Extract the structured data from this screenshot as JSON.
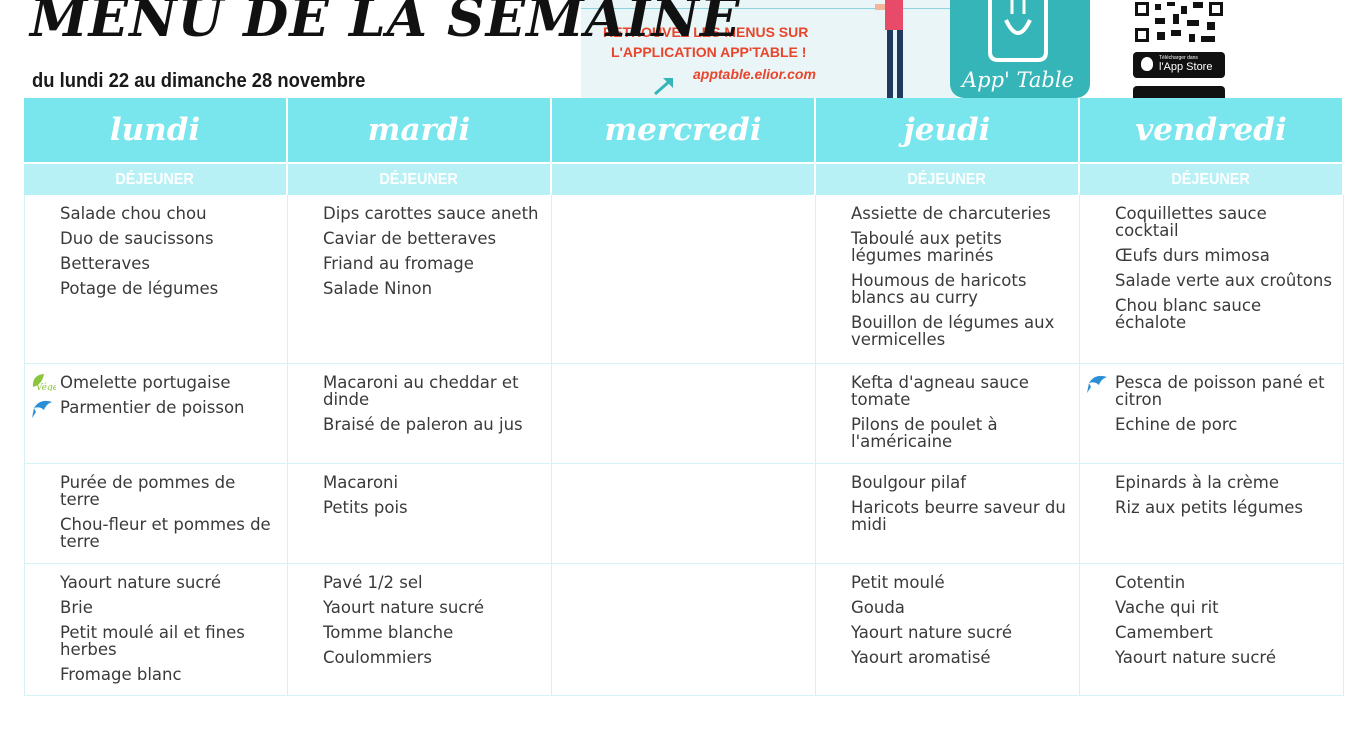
{
  "header": {
    "title": "MENU DE LA SEMAINE",
    "subtitle": "du lundi 22 au dimanche 28 novembre"
  },
  "promo": {
    "line1": "RETROUVEZ LES MENUS SUR",
    "line2": "L'APPLICATION APP'TABLE !",
    "url": "apptable.elior.com",
    "app_name": "App' Table",
    "store_small": "Télécharger dans",
    "store_big": "l'App Store"
  },
  "days": [
    {
      "name": "lundi",
      "meal": "DÉJEUNER"
    },
    {
      "name": "mardi",
      "meal": "DÉJEUNER"
    },
    {
      "name": "mercredi",
      "meal": ""
    },
    {
      "name": "jeudi",
      "meal": "DÉJEUNER"
    },
    {
      "name": "vendredi",
      "meal": "DÉJEUNER"
    }
  ],
  "menu": {
    "starters": [
      [
        "Salade chou chou",
        "Duo de saucissons",
        "Betteraves",
        "Potage de légumes"
      ],
      [
        "Dips carottes sauce aneth",
        "Caviar de betteraves",
        "Friand au fromage",
        "Salade Ninon"
      ],
      [],
      [
        "Assiette de charcuteries",
        "Taboulé aux petits légumes marinés",
        "Houmous de haricots blancs au curry",
        "Bouillon de légumes  aux vermicelles"
      ],
      [
        "Coquillettes sauce cocktail",
        "Œufs durs mimosa",
        "Salade verte aux croûtons",
        "Chou blanc sauce échalote"
      ]
    ],
    "mains": [
      [
        "Omelette portugaise",
        "Parmentier de poisson"
      ],
      [
        "Macaroni au cheddar et dinde",
        "Braisé de paleron au jus"
      ],
      [],
      [
        "Kefta d'agneau sauce tomate",
        "Pilons de poulet à l'américaine"
      ],
      [
        "Pesca de poisson pané et citron",
        "Echine de porc"
      ]
    ],
    "sides": [
      [
        "Purée de pommes de terre",
        "Chou-fleur et pommes de terre"
      ],
      [
        "Macaroni",
        "Petits pois"
      ],
      [],
      [
        "Boulgour pilaf",
        "Haricots beurre saveur du midi"
      ],
      [
        "Epinards à la crème",
        "Riz aux petits légumes"
      ]
    ],
    "dairy": [
      [
        "Yaourt nature sucré",
        "Brie",
        "Petit moulé ail et fines herbes",
        "Fromage blanc"
      ],
      [
        "Pavé 1/2 sel",
        "Yaourt nature sucré",
        "Tomme blanche",
        "Coulommiers"
      ],
      [],
      [
        "Petit moulé",
        "Gouda",
        "Yaourt nature sucré",
        "Yaourt aromatisé"
      ],
      [
        "Cotentin",
        "Vache qui rit",
        "Camembert",
        "Yaourt nature sucré"
      ]
    ]
  },
  "badges": {
    "vege_label": "Végé",
    "vege_icon": "vege-leaf-icon",
    "fish_icon": "fish-icon"
  },
  "colors": {
    "day_header": "#79e6ee",
    "meal_header": "#b8f1f5",
    "promo_text": "#e8452c",
    "app_tile": "#36b5b8"
  }
}
